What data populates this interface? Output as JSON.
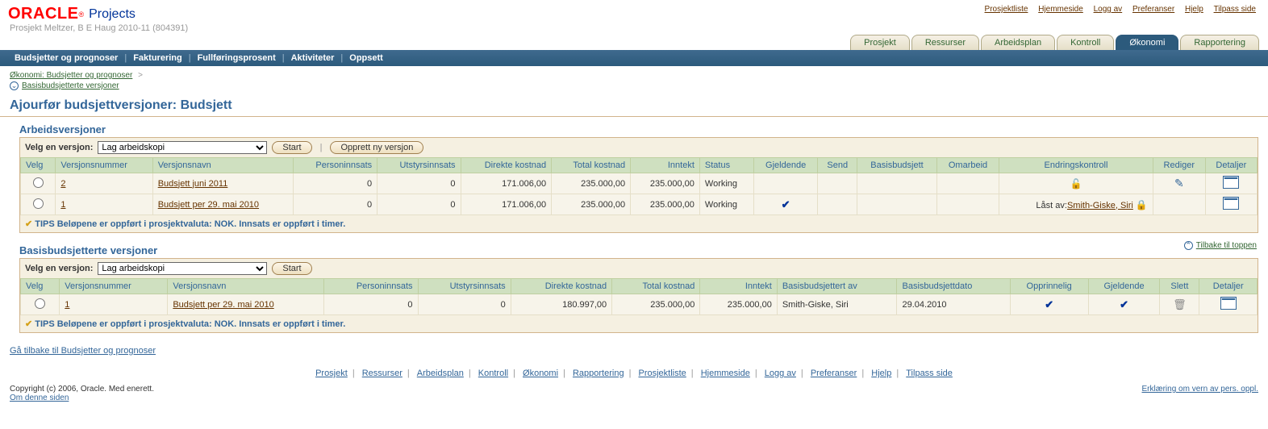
{
  "header": {
    "logo_text": "ORACLE",
    "logo_suffix": "Projects",
    "top_links": [
      "Prosjektliste",
      "Hjemmeside",
      "Logg av",
      "Preferanser",
      "Hjelp",
      "Tilpass side"
    ],
    "subtitle": "Prosjekt Meltzer, B E Haug 2010-11 (804391)"
  },
  "tabs": [
    "Prosjekt",
    "Ressurser",
    "Arbeidsplan",
    "Kontroll",
    "Økonomi",
    "Rapportering"
  ],
  "active_tab": "Økonomi",
  "subnav": [
    "Budsjetter og prognoser",
    "Fakturering",
    "Fullføringsprosent",
    "Aktiviteter",
    "Oppsett"
  ],
  "active_subnav": "Budsjetter og prognoser",
  "breadcrumb": {
    "first": "Økonomi: Budsjetter og prognoser",
    "sep": ">"
  },
  "toggle_link": "Basisbudsjetterte versjoner",
  "page_title": "Ajourfør budsjettversjoner: Budsjett",
  "section1": {
    "title": "Arbeidsversjoner",
    "select_label": "Velg en versjon:",
    "select_value": "Lag arbeidskopi",
    "btn_start": "Start",
    "btn_new": "Opprett ny versjon",
    "cols": [
      "Velg",
      "Versjonsnummer",
      "Versjonsnavn",
      "Personinnsats",
      "Utstyrsinnsats",
      "Direkte kostnad",
      "Total kostnad",
      "Inntekt",
      "Status",
      "Gjeldende",
      "Send",
      "Basisbudsjett",
      "Omarbeid",
      "Endringskontroll",
      "Rediger",
      "Detaljer"
    ],
    "rows": [
      {
        "num": "2",
        "name": "Budsjett juni 2011",
        "p": "0",
        "u": "0",
        "dk": "171.006,00",
        "tk": "235.000,00",
        "inn": "235.000,00",
        "status": "Working",
        "gjeld": false,
        "ek_locked_by": "",
        "ek_prefix": ""
      },
      {
        "num": "1",
        "name": "Budsjett per 29. mai 2010",
        "p": "0",
        "u": "0",
        "dk": "171.006,00",
        "tk": "235.000,00",
        "inn": "235.000,00",
        "status": "Working",
        "gjeld": true,
        "ek_locked_by": "Smith-Giske, Siri",
        "ek_prefix": "Låst av:"
      }
    ],
    "tips": "TIPS Beløpene er oppført i prosjektvaluta: NOK. Innsats er oppført i timer."
  },
  "back_to_top": "Tilbake til toppen",
  "section2": {
    "title": "Basisbudsjetterte versjoner",
    "select_label": "Velg en versjon:",
    "select_value": "Lag arbeidskopi",
    "btn_start": "Start",
    "cols": [
      "Velg",
      "Versjonsnummer",
      "Versjonsnavn",
      "Personinnsats",
      "Utstyrsinnsats",
      "Direkte kostnad",
      "Total kostnad",
      "Inntekt",
      "Basisbudsjettert av",
      "Basisbudsjettdato",
      "Opprinnelig",
      "Gjeldende",
      "Slett",
      "Detaljer"
    ],
    "rows": [
      {
        "num": "1",
        "name": "Budsjett per 29. mai 2010",
        "p": "0",
        "u": "0",
        "dk": "180.997,00",
        "tk": "235.000,00",
        "inn": "235.000,00",
        "by": "Smith-Giske, Siri",
        "date": "29.04.2010"
      }
    ],
    "tips": "TIPS Beløpene er oppført i prosjektvaluta: NOK. Innsats er oppført i timer."
  },
  "back_link": "Gå tilbake til Budsjetter og prognoser",
  "footer_links": [
    "Prosjekt",
    "Ressurser",
    "Arbeidsplan",
    "Kontroll",
    "Økonomi",
    "Rapportering",
    "Prosjektliste",
    "Hjemmeside",
    "Logg av",
    "Preferanser",
    "Hjelp",
    "Tilpass side"
  ],
  "copyright": "Copyright (c) 2006, Oracle. Med enerett.",
  "about": "Om denne siden",
  "privacy": "Erklæring om vern av pers. oppl."
}
